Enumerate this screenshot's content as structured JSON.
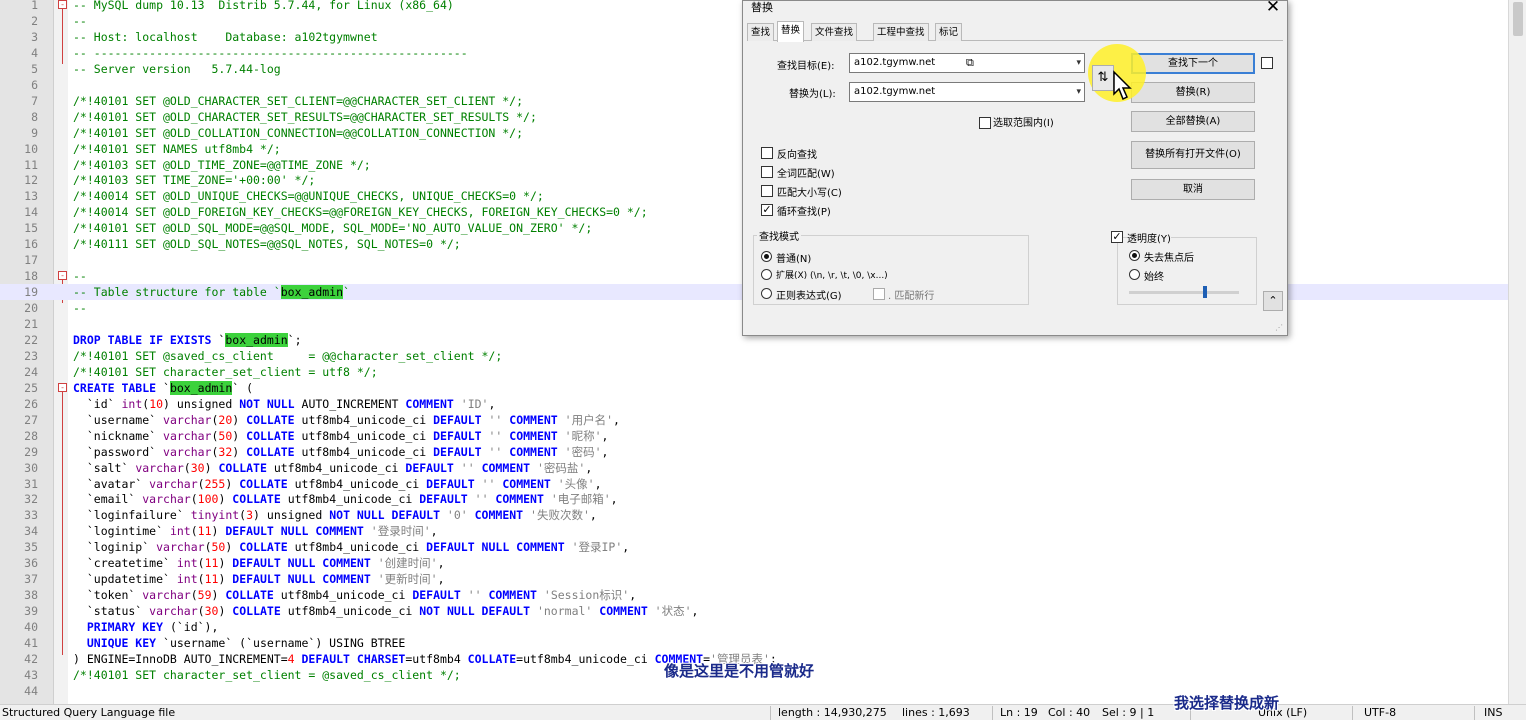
{
  "editor": {
    "lines": [
      {
        "n": "1",
        "fold": "-",
        "parts": [
          [
            "cm",
            "-- MySQL dump 10.13  Distrib 5.7.44, for Linux (x86_64)"
          ]
        ]
      },
      {
        "n": "2",
        "parts": [
          [
            "cm",
            "--"
          ]
        ]
      },
      {
        "n": "3",
        "parts": [
          [
            "cm",
            "-- Host: localhost    Database: a102tgymwnet"
          ]
        ]
      },
      {
        "n": "4",
        "parts": [
          [
            "cm",
            "-- ------------------------------------------------------"
          ]
        ]
      },
      {
        "n": "5",
        "parts": [
          [
            "cm",
            "-- Server version   5.7.44-log"
          ]
        ]
      },
      {
        "n": "6",
        "parts": []
      },
      {
        "n": "7",
        "parts": [
          [
            "cm",
            "/*!40101 SET @OLD_CHARACTER_SET_CLIENT=@@CHARACTER_SET_CLIENT */;"
          ]
        ]
      },
      {
        "n": "8",
        "parts": [
          [
            "cm",
            "/*!40101 SET @OLD_CHARACTER_SET_RESULTS=@@CHARACTER_SET_RESULTS */;"
          ]
        ]
      },
      {
        "n": "9",
        "parts": [
          [
            "cm",
            "/*!40101 SET @OLD_COLLATION_CONNECTION=@@COLLATION_CONNECTION */;"
          ]
        ]
      },
      {
        "n": "10",
        "parts": [
          [
            "cm",
            "/*!40101 SET NAMES utf8mb4 */;"
          ]
        ]
      },
      {
        "n": "11",
        "parts": [
          [
            "cm",
            "/*!40103 SET @OLD_TIME_ZONE=@@TIME_ZONE */;"
          ]
        ]
      },
      {
        "n": "12",
        "parts": [
          [
            "cm",
            "/*!40103 SET TIME_ZONE='+00:00' */;"
          ]
        ]
      },
      {
        "n": "13",
        "parts": [
          [
            "cm",
            "/*!40014 SET @OLD_UNIQUE_CHECKS=@@UNIQUE_CHECKS, UNIQUE_CHECKS=0 */;"
          ]
        ]
      },
      {
        "n": "14",
        "parts": [
          [
            "cm",
            "/*!40014 SET @OLD_FOREIGN_KEY_CHECKS=@@FOREIGN_KEY_CHECKS, FOREIGN_KEY_CHECKS=0 */;"
          ]
        ]
      },
      {
        "n": "15",
        "parts": [
          [
            "cm",
            "/*!40101 SET @OLD_SQL_MODE=@@SQL_MODE, SQL_MODE='NO_AUTO_VALUE_ON_ZERO' */;"
          ]
        ]
      },
      {
        "n": "16",
        "parts": [
          [
            "cm",
            "/*!40111 SET @OLD_SQL_NOTES=@@SQL_NOTES, SQL_NOTES=0 */;"
          ]
        ]
      },
      {
        "n": "17",
        "parts": []
      },
      {
        "n": "18",
        "fold": "-",
        "parts": [
          [
            "cm",
            "--"
          ]
        ]
      },
      {
        "n": "19",
        "current": true,
        "parts": [
          [
            "cm",
            "-- Table structure for table `"
          ],
          [
            "hl",
            "box_admin"
          ],
          [
            "cm",
            "`"
          ]
        ]
      },
      {
        "n": "20",
        "parts": [
          [
            "cm",
            "--"
          ]
        ]
      },
      {
        "n": "21",
        "parts": []
      },
      {
        "n": "22",
        "parts": [
          [
            "kw",
            "DROP TABLE IF EXISTS "
          ],
          [
            "bt",
            "`"
          ],
          [
            "hl",
            "box_admin"
          ],
          [
            "bt",
            "`;"
          ]
        ]
      },
      {
        "n": "23",
        "parts": [
          [
            "cm",
            "/*!40101 SET @saved_cs_client     = @@character_set_client */;"
          ]
        ]
      },
      {
        "n": "24",
        "parts": [
          [
            "cm",
            "/*!40101 SET character_set_client = utf8 */;"
          ]
        ]
      },
      {
        "n": "25",
        "fold": "-",
        "parts": [
          [
            "kw",
            "CREATE TABLE "
          ],
          [
            "bt",
            "`"
          ],
          [
            "hl",
            "box_admin"
          ],
          [
            "bt",
            "` ("
          ]
        ]
      },
      {
        "n": "26",
        "parts": [
          [
            "bt",
            "  `id` "
          ],
          [
            "ty",
            "int"
          ],
          [
            "bt",
            "("
          ],
          [
            "nu",
            "10"
          ],
          [
            "bt",
            ") unsigned "
          ],
          [
            "kw",
            "NOT NULL"
          ],
          [
            "bt",
            " AUTO_INCREMENT "
          ],
          [
            "kw",
            "COMMENT"
          ],
          [
            "st",
            " 'ID'"
          ],
          [
            "bt",
            ","
          ]
        ]
      },
      {
        "n": "27",
        "parts": [
          [
            "bt",
            "  `username` "
          ],
          [
            "ty",
            "varchar"
          ],
          [
            "bt",
            "("
          ],
          [
            "nu",
            "20"
          ],
          [
            "bt",
            ") "
          ],
          [
            "kw",
            "COLLATE"
          ],
          [
            "bt",
            " utf8mb4_unicode_ci "
          ],
          [
            "kw",
            "DEFAULT"
          ],
          [
            "st",
            " '' "
          ],
          [
            "kw",
            "COMMENT"
          ],
          [
            "st",
            " '用户名'"
          ],
          [
            "bt",
            ","
          ]
        ]
      },
      {
        "n": "28",
        "parts": [
          [
            "bt",
            "  `nickname` "
          ],
          [
            "ty",
            "varchar"
          ],
          [
            "bt",
            "("
          ],
          [
            "nu",
            "50"
          ],
          [
            "bt",
            ") "
          ],
          [
            "kw",
            "COLLATE"
          ],
          [
            "bt",
            " utf8mb4_unicode_ci "
          ],
          [
            "kw",
            "DEFAULT"
          ],
          [
            "st",
            " '' "
          ],
          [
            "kw",
            "COMMENT"
          ],
          [
            "st",
            " '昵称'"
          ],
          [
            "bt",
            ","
          ]
        ]
      },
      {
        "n": "29",
        "parts": [
          [
            "bt",
            "  `password` "
          ],
          [
            "ty",
            "varchar"
          ],
          [
            "bt",
            "("
          ],
          [
            "nu",
            "32"
          ],
          [
            "bt",
            ") "
          ],
          [
            "kw",
            "COLLATE"
          ],
          [
            "bt",
            " utf8mb4_unicode_ci "
          ],
          [
            "kw",
            "DEFAULT"
          ],
          [
            "st",
            " '' "
          ],
          [
            "kw",
            "COMMENT"
          ],
          [
            "st",
            " '密码'"
          ],
          [
            "bt",
            ","
          ]
        ]
      },
      {
        "n": "30",
        "parts": [
          [
            "bt",
            "  `salt` "
          ],
          [
            "ty",
            "varchar"
          ],
          [
            "bt",
            "("
          ],
          [
            "nu",
            "30"
          ],
          [
            "bt",
            ") "
          ],
          [
            "kw",
            "COLLATE"
          ],
          [
            "bt",
            " utf8mb4_unicode_ci "
          ],
          [
            "kw",
            "DEFAULT"
          ],
          [
            "st",
            " '' "
          ],
          [
            "kw",
            "COMMENT"
          ],
          [
            "st",
            " '密码盐'"
          ],
          [
            "bt",
            ","
          ]
        ]
      },
      {
        "n": "31",
        "parts": [
          [
            "bt",
            "  `avatar` "
          ],
          [
            "ty",
            "varchar"
          ],
          [
            "bt",
            "("
          ],
          [
            "nu",
            "255"
          ],
          [
            "bt",
            ") "
          ],
          [
            "kw",
            "COLLATE"
          ],
          [
            "bt",
            " utf8mb4_unicode_ci "
          ],
          [
            "kw",
            "DEFAULT"
          ],
          [
            "st",
            " '' "
          ],
          [
            "kw",
            "COMMENT"
          ],
          [
            "st",
            " '头像'"
          ],
          [
            "bt",
            ","
          ]
        ]
      },
      {
        "n": "32",
        "parts": [
          [
            "bt",
            "  `email` "
          ],
          [
            "ty",
            "varchar"
          ],
          [
            "bt",
            "("
          ],
          [
            "nu",
            "100"
          ],
          [
            "bt",
            ") "
          ],
          [
            "kw",
            "COLLATE"
          ],
          [
            "bt",
            " utf8mb4_unicode_ci "
          ],
          [
            "kw",
            "DEFAULT"
          ],
          [
            "st",
            " '' "
          ],
          [
            "kw",
            "COMMENT"
          ],
          [
            "st",
            " '电子邮箱'"
          ],
          [
            "bt",
            ","
          ]
        ]
      },
      {
        "n": "33",
        "parts": [
          [
            "bt",
            "  `loginfailure` "
          ],
          [
            "ty",
            "tinyint"
          ],
          [
            "bt",
            "("
          ],
          [
            "nu",
            "3"
          ],
          [
            "bt",
            ") unsigned "
          ],
          [
            "kw",
            "NOT NULL DEFAULT"
          ],
          [
            "st",
            " '0' "
          ],
          [
            "kw",
            "COMMENT"
          ],
          [
            "st",
            " '失败次数'"
          ],
          [
            "bt",
            ","
          ]
        ]
      },
      {
        "n": "34",
        "parts": [
          [
            "bt",
            "  `logintime` "
          ],
          [
            "ty",
            "int"
          ],
          [
            "bt",
            "("
          ],
          [
            "nu",
            "11"
          ],
          [
            "bt",
            ") "
          ],
          [
            "kw",
            "DEFAULT NULL COMMENT"
          ],
          [
            "st",
            " '登录时间'"
          ],
          [
            "bt",
            ","
          ]
        ]
      },
      {
        "n": "35",
        "parts": [
          [
            "bt",
            "  `loginip` "
          ],
          [
            "ty",
            "varchar"
          ],
          [
            "bt",
            "("
          ],
          [
            "nu",
            "50"
          ],
          [
            "bt",
            ") "
          ],
          [
            "kw",
            "COLLATE"
          ],
          [
            "bt",
            " utf8mb4_unicode_ci "
          ],
          [
            "kw",
            "DEFAULT NULL COMMENT"
          ],
          [
            "st",
            " '登录IP'"
          ],
          [
            "bt",
            ","
          ]
        ]
      },
      {
        "n": "36",
        "parts": [
          [
            "bt",
            "  `createtime` "
          ],
          [
            "ty",
            "int"
          ],
          [
            "bt",
            "("
          ],
          [
            "nu",
            "11"
          ],
          [
            "bt",
            ") "
          ],
          [
            "kw",
            "DEFAULT NULL COMMENT"
          ],
          [
            "st",
            " '创建时间'"
          ],
          [
            "bt",
            ","
          ]
        ]
      },
      {
        "n": "37",
        "parts": [
          [
            "bt",
            "  `updatetime` "
          ],
          [
            "ty",
            "int"
          ],
          [
            "bt",
            "("
          ],
          [
            "nu",
            "11"
          ],
          [
            "bt",
            ") "
          ],
          [
            "kw",
            "DEFAULT NULL COMMENT"
          ],
          [
            "st",
            " '更新时间'"
          ],
          [
            "bt",
            ","
          ]
        ]
      },
      {
        "n": "38",
        "parts": [
          [
            "bt",
            "  `token` "
          ],
          [
            "ty",
            "varchar"
          ],
          [
            "bt",
            "("
          ],
          [
            "nu",
            "59"
          ],
          [
            "bt",
            ") "
          ],
          [
            "kw",
            "COLLATE"
          ],
          [
            "bt",
            " utf8mb4_unicode_ci "
          ],
          [
            "kw",
            "DEFAULT"
          ],
          [
            "st",
            " '' "
          ],
          [
            "kw",
            "COMMENT"
          ],
          [
            "st",
            " 'Session标识'"
          ],
          [
            "bt",
            ","
          ]
        ]
      },
      {
        "n": "39",
        "parts": [
          [
            "bt",
            "  `status` "
          ],
          [
            "ty",
            "varchar"
          ],
          [
            "bt",
            "("
          ],
          [
            "nu",
            "30"
          ],
          [
            "bt",
            ") "
          ],
          [
            "kw",
            "COLLATE"
          ],
          [
            "bt",
            " utf8mb4_unicode_ci "
          ],
          [
            "kw",
            "NOT NULL DEFAULT"
          ],
          [
            "st",
            " 'normal' "
          ],
          [
            "kw",
            "COMMENT"
          ],
          [
            "st",
            " '状态'"
          ],
          [
            "bt",
            ","
          ]
        ]
      },
      {
        "n": "40",
        "parts": [
          [
            "kw",
            "  PRIMARY KEY"
          ],
          [
            "bt",
            " (`id`),"
          ]
        ]
      },
      {
        "n": "41",
        "parts": [
          [
            "kw",
            "  UNIQUE KEY"
          ],
          [
            "bt",
            " `username` (`username`) USING BTREE"
          ]
        ]
      },
      {
        "n": "42",
        "parts": [
          [
            "bt",
            ") ENGINE=InnoDB AUTO_INCREMENT="
          ],
          [
            "nu",
            "4"
          ],
          [
            "kw",
            " DEFAULT CHARSET"
          ],
          [
            "bt",
            "=utf8mb4 "
          ],
          [
            "kw",
            "COLLATE"
          ],
          [
            "bt",
            "=utf8mb4_unicode_ci "
          ],
          [
            "kw",
            "COMMENT"
          ],
          [
            "bt",
            "="
          ],
          [
            "st",
            "'管理员表'"
          ],
          [
            "bt",
            ";"
          ]
        ]
      },
      {
        "n": "43",
        "parts": [
          [
            "cm",
            "/*!40101 SET character_set_client = @saved_cs_client */;"
          ]
        ]
      },
      {
        "n": "44",
        "parts": []
      }
    ]
  },
  "dialog": {
    "title": "替换",
    "close": "✕",
    "tabs": [
      "查找",
      "替换",
      "文件查找",
      "工程中查找",
      "标记"
    ],
    "find_label": "查找目标(E):",
    "find_value": "a102.tgymw.net",
    "replace_label": "替换为(L):",
    "replace_value": "a102.tgymw.net",
    "swap_glyph": "⇅",
    "in_selection": "选取范围内(I)",
    "btn_find_next": "查找下一个",
    "btn_replace": "替换(R)",
    "btn_replace_all": "全部替换(A)",
    "btn_replace_all_open": "替换所有打开文件(O)",
    "btn_cancel": "取消",
    "opt_backward": "反向查找",
    "opt_whole_word": "全词匹配(W)",
    "opt_match_case": "匹配大小写(C)",
    "opt_wrap": "循环查找(P)",
    "search_mode_title": "查找模式",
    "mode_normal": "普通(N)",
    "mode_extended": "扩展(X) (\\n, \\r, \\t, \\0, \\x...)",
    "mode_regex": "正则表达式(G)",
    "dot_newline": ". 匹配新行",
    "transparency": "透明度(Y)",
    "on_lose_focus": "失去焦点后",
    "always": "始终",
    "transparency_level": 0.7
  },
  "statusbar": {
    "file_type": "Structured Query Language file",
    "length": "length : 14,930,275",
    "lines": "lines : 1,693",
    "ln": "Ln : 19",
    "col": "Col : 40",
    "sel": "Sel : 9 | 1",
    "eol": "Unix (LF)",
    "encoding": "UTF-8",
    "mode": "INS"
  },
  "subtitles": {
    "center": "像是这里是不用管就好",
    "right": "我选择替换成新"
  }
}
